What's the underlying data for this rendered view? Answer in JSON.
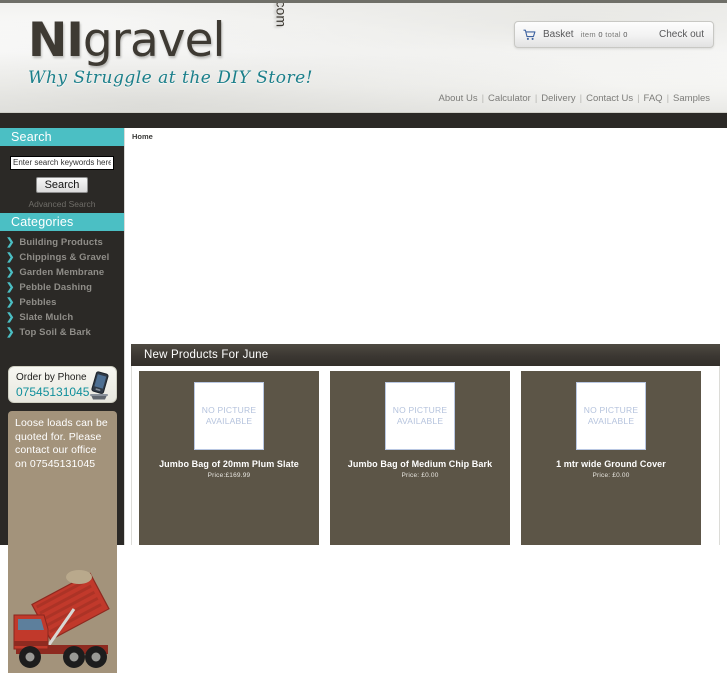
{
  "header": {
    "logo": {
      "part1": "NI",
      "part2": "gravel",
      "dotcom": ".com",
      "tagline": "Why Struggle at the DIY Store!"
    },
    "basket": {
      "cart_icon": "shopping-cart-icon",
      "label": "Basket",
      "item_word": "item",
      "item_count": "0",
      "total_word": "total",
      "total_value": "0",
      "checkout_label": "Check out"
    },
    "nav": [
      {
        "label": "About Us"
      },
      {
        "label": "Calculator"
      },
      {
        "label": "Delivery"
      },
      {
        "label": "Contact Us"
      },
      {
        "label": "FAQ"
      },
      {
        "label": "Samples"
      }
    ],
    "nav_separator": "|"
  },
  "sidebar": {
    "search": {
      "title": "Search",
      "input_value": "Enter search keywords here",
      "input_placeholder": "Enter search keywords here",
      "button_label": "Search",
      "advanced_label": "Advanced Search"
    },
    "categories": {
      "title": "Categories",
      "arrow_icon": "chevron-right-icon",
      "items": [
        {
          "label": "Building Products"
        },
        {
          "label": "Chippings & Gravel"
        },
        {
          "label": "Garden Membrane"
        },
        {
          "label": "Pebble Dashing"
        },
        {
          "label": "Pebbles"
        },
        {
          "label": "Slate Mulch"
        },
        {
          "label": "Top Soil & Bark"
        }
      ]
    },
    "order_phone": {
      "line1": "Order by Phone",
      "line2": "07545131045",
      "icon": "mobile-phone-icon"
    },
    "loose_loads": {
      "text": "Loose loads can be quoted for. Please contact our office on  07545131045",
      "image": "red-tipper-truck-image"
    }
  },
  "content": {
    "breadcrumb": "Home",
    "new_products": {
      "title": "New Products For June",
      "no_picture_line1": "NO PICTURE",
      "no_picture_line2": "AVAILABLE",
      "items": [
        {
          "name": "Jumbo Bag of 20mm Plum Slate",
          "price": "Price:£169.99"
        },
        {
          "name": "Jumbo Bag of Medium Chip Bark",
          "price": "Price: £0.00"
        },
        {
          "name": "1 mtr wide Ground Cover",
          "price": "Price: £0.00"
        }
      ]
    }
  },
  "colors": {
    "teal": "#4bbfc4",
    "dark": "#2b2926",
    "card": "#5c5547",
    "promo": "#a3937b",
    "logo_text": "#3e3a33",
    "tagline": "#1b7f8a"
  }
}
